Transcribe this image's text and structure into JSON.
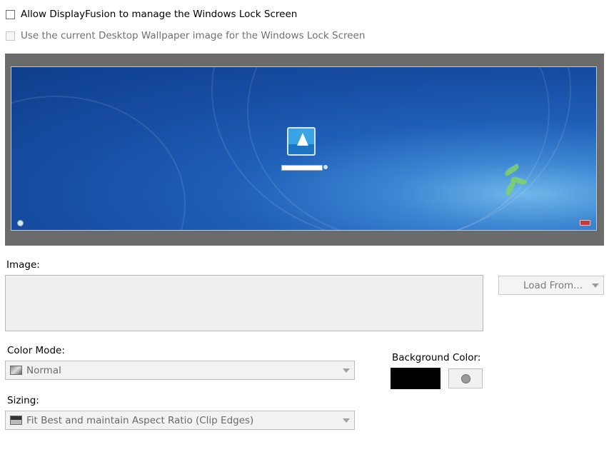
{
  "options": {
    "manage_lock_screen": {
      "label": "Allow DisplayFusion to manage the Windows Lock Screen",
      "checked": false,
      "enabled": true
    },
    "use_desktop_wallpaper": {
      "label": "Use the current Desktop Wallpaper image for the Windows Lock Screen",
      "checked": false,
      "enabled": false
    }
  },
  "image": {
    "label": "Image:",
    "load_from_label": "Load From..."
  },
  "color_mode": {
    "label": "Color Mode:",
    "selected": "Normal",
    "icon": "color-mode-normal-icon"
  },
  "background_color": {
    "label": "Background Color:",
    "value": "#000000"
  },
  "sizing": {
    "label": "Sizing:",
    "selected": "Fit Best and maintain Aspect Ratio (Clip Edges)",
    "icon": "sizing-fit-icon"
  }
}
